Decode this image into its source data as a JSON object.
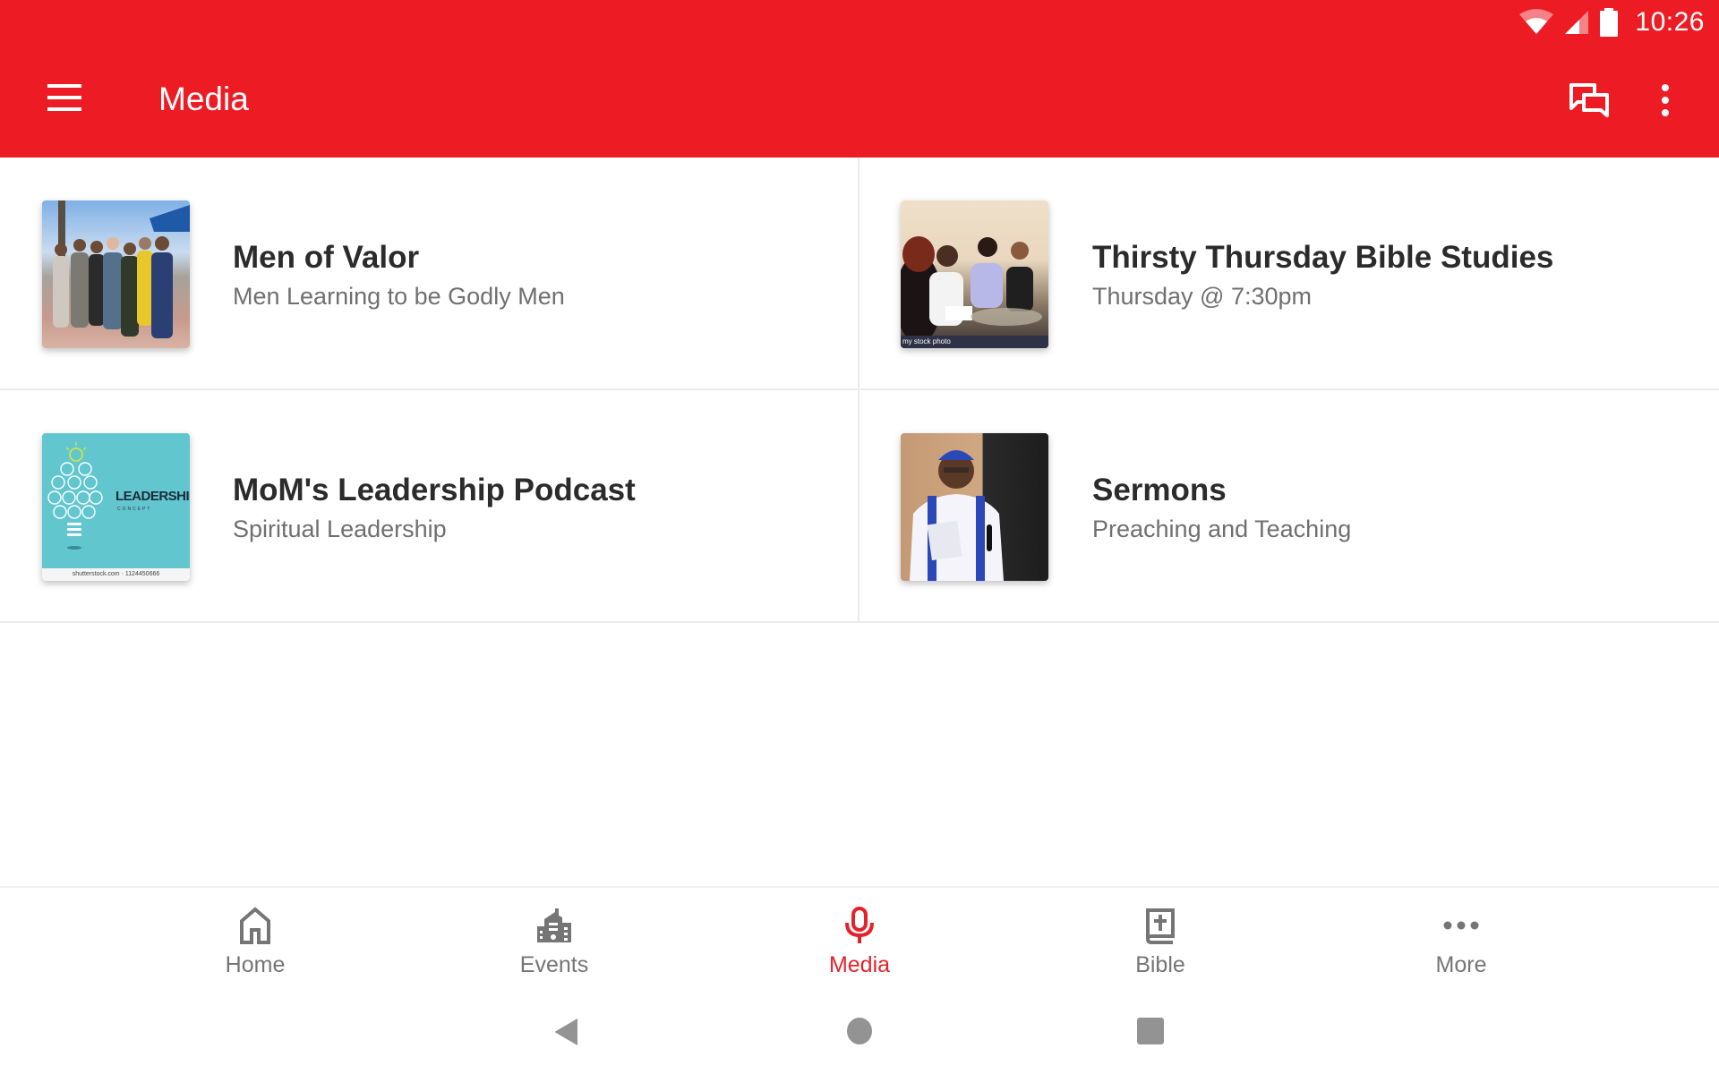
{
  "colors": {
    "brand": "#ed1c24",
    "active": "#e3232c",
    "inactive": "#757575"
  },
  "status_bar": {
    "time": "10:26",
    "icons": [
      "wifi-icon",
      "cell-signal-icon",
      "battery-icon"
    ]
  },
  "toolbar": {
    "menu_icon": "hamburger-menu-icon",
    "title": "Media",
    "actions": [
      "chat-icon",
      "overflow-menu-icon"
    ]
  },
  "media_items": [
    {
      "title": "Men of Valor",
      "subtitle": "Men Learning to be Godly Men",
      "thumbnail": "group-photo-men"
    },
    {
      "title": "Thirsty Thursday Bible Studies",
      "subtitle": "Thursday @ 7:30pm",
      "thumbnail": "bible-study-photo",
      "thumbnail_caption": "my stock photo"
    },
    {
      "title": "MoM's Leadership Podcast",
      "subtitle": "Spiritual Leadership",
      "thumbnail": "leadership-lightbulbs",
      "thumbnail_text": "LEADERSHIP",
      "thumbnail_subtext": "CONCEPT",
      "thumbnail_footer": "shutterstock.com · 1124450666"
    },
    {
      "title": "Sermons",
      "subtitle": "Preaching and Teaching",
      "thumbnail": "preacher-photo"
    }
  ],
  "bottom_nav": {
    "items": [
      {
        "label": "Home",
        "icon": "home-icon",
        "active": false
      },
      {
        "label": "Events",
        "icon": "building-icon",
        "active": false
      },
      {
        "label": "Media",
        "icon": "microphone-icon",
        "active": true
      },
      {
        "label": "Bible",
        "icon": "bible-icon",
        "active": false
      },
      {
        "label": "More",
        "icon": "more-dots-icon",
        "active": false
      }
    ]
  },
  "system_nav": [
    "back-icon",
    "home-circle-icon",
    "recents-icon"
  ]
}
